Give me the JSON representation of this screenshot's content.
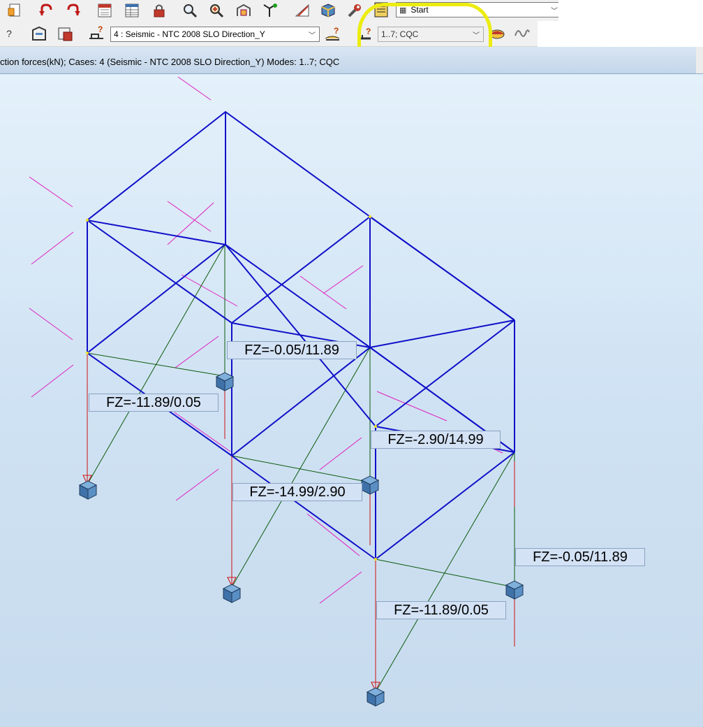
{
  "toolbar": {
    "row1_icons": [
      "document-icon",
      "undo-icon",
      "redo-icon",
      "calculator-icon",
      "table-icon",
      "lock-icon",
      "zoom-icon",
      "zoom-window-icon",
      "structure-icon",
      "axis-icon",
      "section-icon",
      "cube-icon",
      "wrench-icon",
      "layout-icon"
    ],
    "layout_combo": {
      "icon": "layout-grid-icon",
      "value": "Start"
    },
    "row2_prefix": "?",
    "load_case_combo": {
      "value": "4 : Seismic - NTC 2008 SLO Direction_Y"
    },
    "modes_combo": {
      "value": "1..7; CQC"
    }
  },
  "view": {
    "title": "ction forces(kN); Cases: 4 (Seismic - NTC 2008 SLO Direction_Y) Modes: 1..7; CQC",
    "labels": [
      "FZ=-0.05/11.89",
      "FZ=-11.89/0.05",
      "FZ=-2.90/14.99",
      "FZ=-14.99/2.90",
      "FZ=-0.05/11.89",
      "FZ=-11.89/0.05"
    ]
  },
  "colors": {
    "frame": "#1010c8",
    "support_lines": "#0b5a0b",
    "reaction_arrows": "#d01010",
    "magenta": "#e020c0",
    "highlight": "#ecec10",
    "support_cube": "#4f86bf"
  }
}
